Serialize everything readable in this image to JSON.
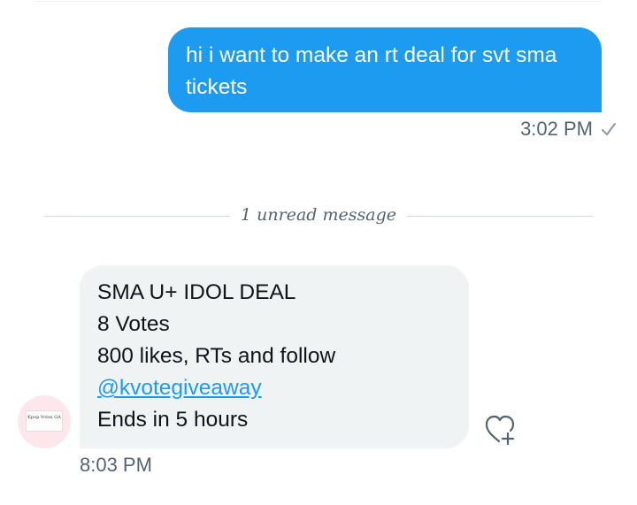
{
  "conversation": {
    "sent_message": {
      "text": "hi i want to make an rt deal for svt sma tickets",
      "time": "3:02 PM",
      "status_icon": "check-icon"
    },
    "unread_divider": {
      "label": "1 unread message"
    },
    "received_message": {
      "lines": [
        "SMA U+ IDOL DEAL",
        "8 Votes",
        "800 likes, RTs and follow",
        "@kvotegiveaway",
        "Ends in 5 hours"
      ],
      "time": "8:03 PM",
      "avatar_text": "Kpop Votes GA",
      "reaction_icon": "heart-plus-icon"
    }
  },
  "colors": {
    "sent_bubble": "#1d9bf0",
    "received_bubble": "#eff3f4",
    "link": "#1d9bf0",
    "meta_text": "#536471"
  }
}
